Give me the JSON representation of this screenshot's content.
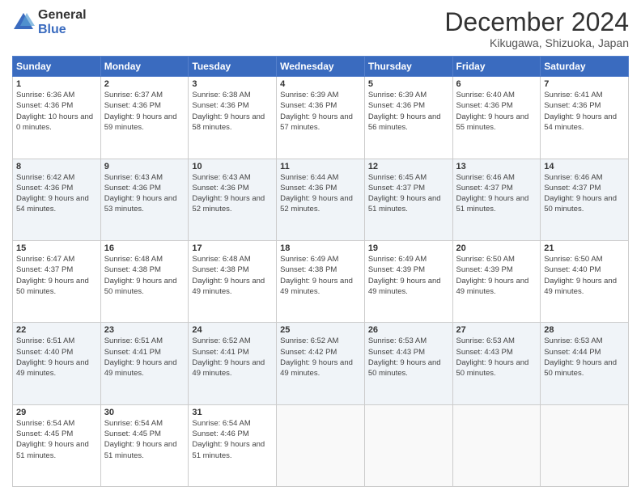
{
  "header": {
    "logo_line1": "General",
    "logo_line2": "Blue",
    "title": "December 2024",
    "subtitle": "Kikugawa, Shizuoka, Japan"
  },
  "calendar": {
    "weekdays": [
      "Sunday",
      "Monday",
      "Tuesday",
      "Wednesday",
      "Thursday",
      "Friday",
      "Saturday"
    ],
    "weeks": [
      [
        {
          "day": "1",
          "sunrise": "6:36 AM",
          "sunset": "4:36 PM",
          "daylight": "10 hours and 0 minutes."
        },
        {
          "day": "2",
          "sunrise": "6:37 AM",
          "sunset": "4:36 PM",
          "daylight": "9 hours and 59 minutes."
        },
        {
          "day": "3",
          "sunrise": "6:38 AM",
          "sunset": "4:36 PM",
          "daylight": "9 hours and 58 minutes."
        },
        {
          "day": "4",
          "sunrise": "6:39 AM",
          "sunset": "4:36 PM",
          "daylight": "9 hours and 57 minutes."
        },
        {
          "day": "5",
          "sunrise": "6:39 AM",
          "sunset": "4:36 PM",
          "daylight": "9 hours and 56 minutes."
        },
        {
          "day": "6",
          "sunrise": "6:40 AM",
          "sunset": "4:36 PM",
          "daylight": "9 hours and 55 minutes."
        },
        {
          "day": "7",
          "sunrise": "6:41 AM",
          "sunset": "4:36 PM",
          "daylight": "9 hours and 54 minutes."
        }
      ],
      [
        {
          "day": "8",
          "sunrise": "6:42 AM",
          "sunset": "4:36 PM",
          "daylight": "9 hours and 54 minutes."
        },
        {
          "day": "9",
          "sunrise": "6:43 AM",
          "sunset": "4:36 PM",
          "daylight": "9 hours and 53 minutes."
        },
        {
          "day": "10",
          "sunrise": "6:43 AM",
          "sunset": "4:36 PM",
          "daylight": "9 hours and 52 minutes."
        },
        {
          "day": "11",
          "sunrise": "6:44 AM",
          "sunset": "4:36 PM",
          "daylight": "9 hours and 52 minutes."
        },
        {
          "day": "12",
          "sunrise": "6:45 AM",
          "sunset": "4:37 PM",
          "daylight": "9 hours and 51 minutes."
        },
        {
          "day": "13",
          "sunrise": "6:46 AM",
          "sunset": "4:37 PM",
          "daylight": "9 hours and 51 minutes."
        },
        {
          "day": "14",
          "sunrise": "6:46 AM",
          "sunset": "4:37 PM",
          "daylight": "9 hours and 50 minutes."
        }
      ],
      [
        {
          "day": "15",
          "sunrise": "6:47 AM",
          "sunset": "4:37 PM",
          "daylight": "9 hours and 50 minutes."
        },
        {
          "day": "16",
          "sunrise": "6:48 AM",
          "sunset": "4:38 PM",
          "daylight": "9 hours and 50 minutes."
        },
        {
          "day": "17",
          "sunrise": "6:48 AM",
          "sunset": "4:38 PM",
          "daylight": "9 hours and 49 minutes."
        },
        {
          "day": "18",
          "sunrise": "6:49 AM",
          "sunset": "4:38 PM",
          "daylight": "9 hours and 49 minutes."
        },
        {
          "day": "19",
          "sunrise": "6:49 AM",
          "sunset": "4:39 PM",
          "daylight": "9 hours and 49 minutes."
        },
        {
          "day": "20",
          "sunrise": "6:50 AM",
          "sunset": "4:39 PM",
          "daylight": "9 hours and 49 minutes."
        },
        {
          "day": "21",
          "sunrise": "6:50 AM",
          "sunset": "4:40 PM",
          "daylight": "9 hours and 49 minutes."
        }
      ],
      [
        {
          "day": "22",
          "sunrise": "6:51 AM",
          "sunset": "4:40 PM",
          "daylight": "9 hours and 49 minutes."
        },
        {
          "day": "23",
          "sunrise": "6:51 AM",
          "sunset": "4:41 PM",
          "daylight": "9 hours and 49 minutes."
        },
        {
          "day": "24",
          "sunrise": "6:52 AM",
          "sunset": "4:41 PM",
          "daylight": "9 hours and 49 minutes."
        },
        {
          "day": "25",
          "sunrise": "6:52 AM",
          "sunset": "4:42 PM",
          "daylight": "9 hours and 49 minutes."
        },
        {
          "day": "26",
          "sunrise": "6:53 AM",
          "sunset": "4:43 PM",
          "daylight": "9 hours and 50 minutes."
        },
        {
          "day": "27",
          "sunrise": "6:53 AM",
          "sunset": "4:43 PM",
          "daylight": "9 hours and 50 minutes."
        },
        {
          "day": "28",
          "sunrise": "6:53 AM",
          "sunset": "4:44 PM",
          "daylight": "9 hours and 50 minutes."
        }
      ],
      [
        {
          "day": "29",
          "sunrise": "6:54 AM",
          "sunset": "4:45 PM",
          "daylight": "9 hours and 51 minutes."
        },
        {
          "day": "30",
          "sunrise": "6:54 AM",
          "sunset": "4:45 PM",
          "daylight": "9 hours and 51 minutes."
        },
        {
          "day": "31",
          "sunrise": "6:54 AM",
          "sunset": "4:46 PM",
          "daylight": "9 hours and 51 minutes."
        },
        null,
        null,
        null,
        null
      ]
    ]
  }
}
